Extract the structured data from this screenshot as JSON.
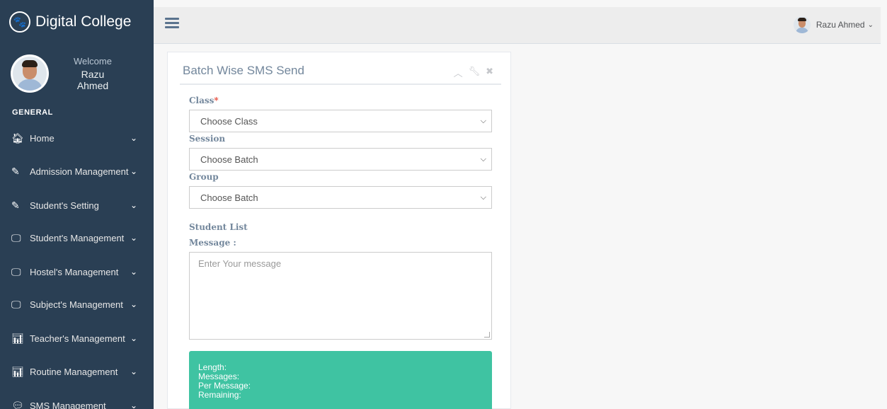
{
  "sidebar": {
    "brand": {
      "title": "Digital College",
      "icon": "paw-icon"
    },
    "profile": {
      "welcome": "Welcome",
      "name": "Razu Ahmed"
    },
    "section_title": "GENERAL",
    "items": [
      {
        "label": "Home",
        "icon": "home-icon"
      },
      {
        "label": "Admission Management",
        "icon": "edit-icon"
      },
      {
        "label": "Student's Setting",
        "icon": "edit-icon"
      },
      {
        "label": "Student's Management",
        "icon": "desktop-icon"
      },
      {
        "label": "Hostel's Management",
        "icon": "desktop-icon"
      },
      {
        "label": "Subject's Management",
        "icon": "desktop-icon"
      },
      {
        "label": "Teacher's Management",
        "icon": "bar-chart-icon"
      },
      {
        "label": "Routine Management",
        "icon": "bar-chart-icon"
      },
      {
        "label": "SMS Management",
        "icon": "comments-icon"
      }
    ]
  },
  "topnav": {
    "user_name": "Razu Ahmed"
  },
  "panel": {
    "title": "Batch Wise SMS Send",
    "class_label": "Class",
    "required_mark": "*",
    "class_select": "Choose Class",
    "session_label": "Session",
    "session_select": "Choose Batch",
    "group_label": "Group",
    "group_select": "Choose Batch",
    "student_list_label": "Student List",
    "message_label": "Message :",
    "message_placeholder": "Enter Your message",
    "sms_info": {
      "length": "Length:",
      "messages": "Messages:",
      "per_message": "Per Message:",
      "remaining": "Remaining:"
    }
  },
  "colors": {
    "sidebar_bg": "#2a3f54",
    "info_box": "#3fc3a2",
    "label": "#73879c",
    "required": "#e74c3c"
  }
}
